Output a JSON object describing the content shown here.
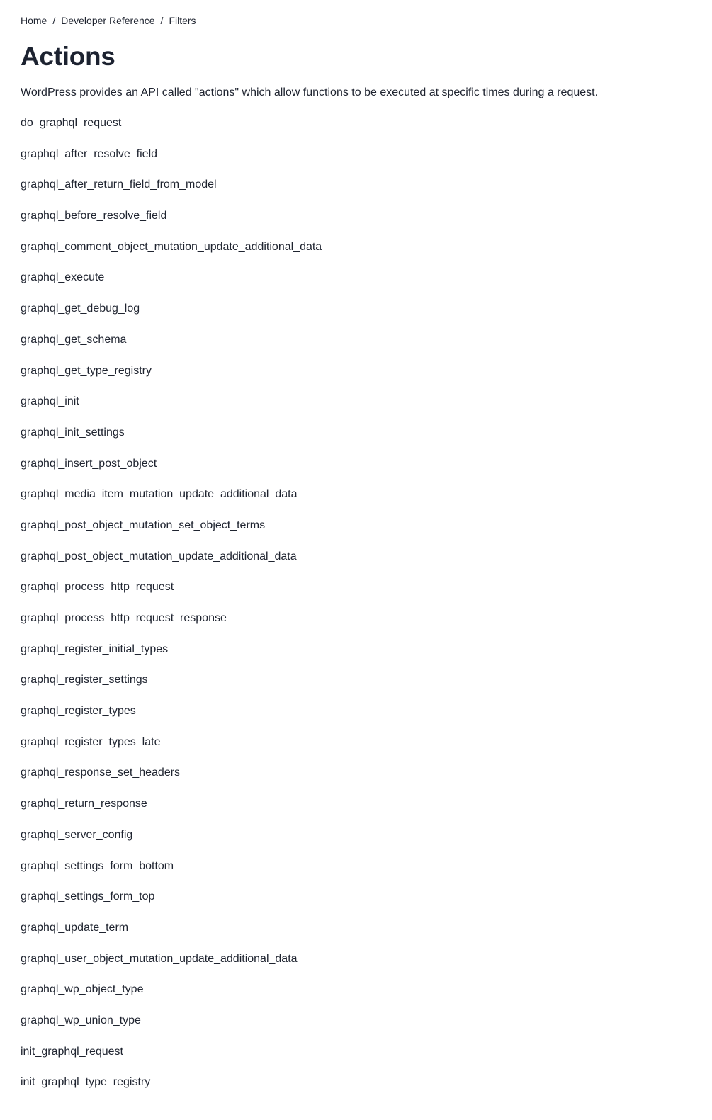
{
  "breadcrumb": {
    "items": [
      {
        "label": "Home"
      },
      {
        "label": "Developer Reference"
      },
      {
        "label": "Filters"
      }
    ],
    "separator": "/"
  },
  "page": {
    "title": "Actions",
    "intro": "WordPress provides an API called \"actions\" which allow functions to be executed at specific times during a request."
  },
  "actions": [
    "do_graphql_request",
    "graphql_after_resolve_field",
    "graphql_after_return_field_from_model",
    "graphql_before_resolve_field",
    "graphql_comment_object_mutation_update_additional_data",
    "graphql_execute",
    "graphql_get_debug_log",
    "graphql_get_schema",
    "graphql_get_type_registry",
    "graphql_init",
    "graphql_init_settings",
    "graphql_insert_post_object",
    "graphql_media_item_mutation_update_additional_data",
    "graphql_post_object_mutation_set_object_terms",
    "graphql_post_object_mutation_update_additional_data",
    "graphql_process_http_request",
    "graphql_process_http_request_response",
    "graphql_register_initial_types",
    "graphql_register_settings",
    "graphql_register_types",
    "graphql_register_types_late",
    "graphql_response_set_headers",
    "graphql_return_response",
    "graphql_server_config",
    "graphql_settings_form_bottom",
    "graphql_settings_form_top",
    "graphql_update_term",
    "graphql_user_object_mutation_update_additional_data",
    "graphql_wp_object_type",
    "graphql_wp_union_type",
    "init_graphql_request",
    "init_graphql_type_registry"
  ]
}
